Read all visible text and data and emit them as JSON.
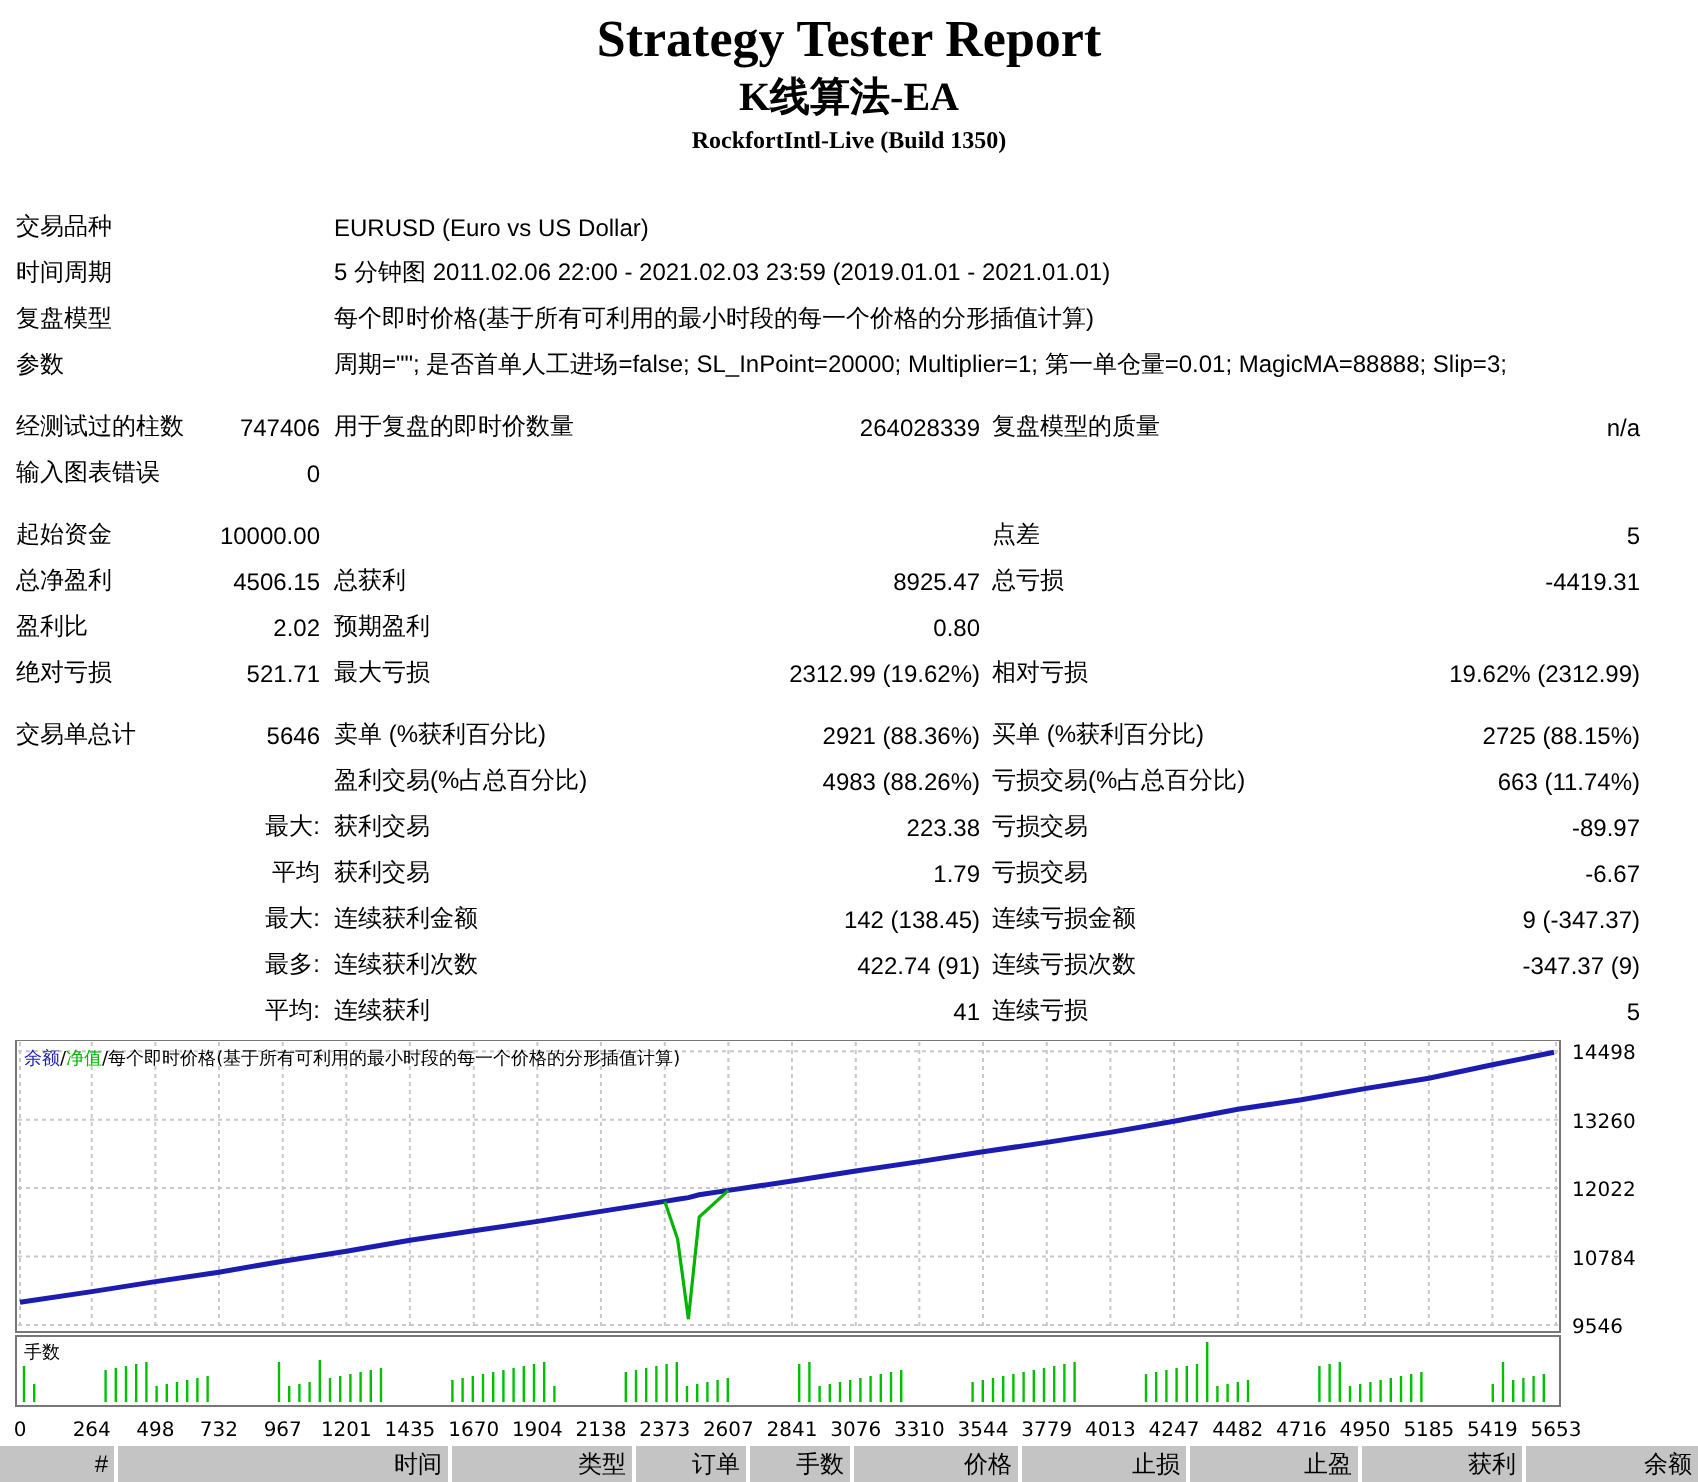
{
  "report": {
    "title": "Strategy Tester Report",
    "expert": "K线算法-EA",
    "server": "RockfortIntl-Live (Build 1350)"
  },
  "sections": [
    [
      {
        "label": "交易品种",
        "text": "EURUSD (Euro vs US Dollar)"
      },
      {
        "label": "时间周期",
        "text": "5 分钟图 2011.02.06 22:00 - 2021.02.03 23:59 (2019.01.01 - 2021.01.01)"
      },
      {
        "label": "复盘模型",
        "text": "每个即时价格(基于所有可利用的最小时段的每一个价格的分形插值计算)"
      },
      {
        "label": "参数",
        "text": "周期=\"\"; 是否首单人工进场=false; SL_InPoint=20000; Multiplier=1; 第一单仓量=0.01; MagicMA=88888; Slip=3;"
      }
    ],
    [
      {
        "label": "经测试过的柱数",
        "value": "747406",
        "label_2": "用于复盘的即时价数量",
        "value_2": "264028339",
        "label_3": "复盘模型的质量",
        "value_3": "n/a"
      },
      {
        "label": "输入图表错误",
        "value": "0"
      }
    ],
    [
      {
        "label": "起始资金",
        "value": "10000.00",
        "label_3": "点差",
        "value_3": "5"
      },
      {
        "label": "总净盈利",
        "value": "4506.15",
        "label_2": "总获利",
        "value_2": "8925.47",
        "label_3": "总亏损",
        "value_3": "-4419.31"
      },
      {
        "label": "盈利比",
        "value": "2.02",
        "label_2": "预期盈利",
        "value_2": "0.80"
      },
      {
        "label": "绝对亏损",
        "value": "521.71",
        "label_2": "最大亏损",
        "value_2": "2312.99 (19.62%)",
        "label_3": "相对亏损",
        "value_3": "19.62% (2312.99)"
      }
    ],
    [
      {
        "label": "交易单总计",
        "value": "5646",
        "label_2": "卖单 (%获利百分比)",
        "value_2": "2921 (88.36%)",
        "label_3": "买单 (%获利百分比)",
        "value_3": "2725 (88.15%)"
      },
      {
        "label_2": "盈利交易(%占总百分比)",
        "value_2": "4983 (88.26%)",
        "label_3": "亏损交易(%占总百分比)",
        "value_3": "663 (11.74%)"
      },
      {
        "prefix": "最大:",
        "label_2": "获利交易",
        "value_2": "223.38",
        "label_3": "亏损交易",
        "value_3": "-89.97"
      },
      {
        "prefix": "平均",
        "label_2": "获利交易",
        "value_2": "1.79",
        "label_3": "亏损交易",
        "value_3": "-6.67"
      },
      {
        "prefix": "最大:",
        "label_2": "连续获利金额",
        "value_2": "142 (138.45)",
        "label_3": "连续亏损金额",
        "value_3": "9 (-347.37)"
      },
      {
        "prefix": "最多:",
        "label_2": "连续获利次数",
        "value_2": "422.74 (91)",
        "label_3": "连续亏损次数",
        "value_3": "-347.37 (9)"
      },
      {
        "prefix": "平均:",
        "label_2": "连续获利",
        "value_2": "41",
        "label_3": "连续亏损",
        "value_3": "5"
      }
    ]
  ],
  "chart": {
    "legend": [
      {
        "kind": "series"
      },
      {
        "kind": "separator",
        "text": "/"
      },
      {
        "kind": "series"
      },
      {
        "kind": "separator",
        "text": "/"
      },
      {
        "kind": "note",
        "text": "每个即时价格(基于所有可利用的最小时段的每一个价格的分形插值计算)"
      }
    ],
    "volume_label": "手数",
    "chart_data": {
      "type": "line",
      "x": [
        0,
        264,
        498,
        732,
        967,
        1201,
        1435,
        1670,
        1904,
        2138,
        2373,
        2420,
        2460,
        2500,
        2607,
        2841,
        3076,
        3310,
        3544,
        3779,
        4013,
        4247,
        4482,
        4716,
        4950,
        5185,
        5419,
        5646
      ],
      "series": [
        {
          "name": "余额",
          "color": "#1c1cb0",
          "values": [
            9960,
            10150,
            10330,
            10500,
            10700,
            10880,
            11080,
            11250,
            11420,
            11600,
            11780,
            11820,
            11850,
            11900,
            11980,
            12150,
            12330,
            12500,
            12680,
            12850,
            13030,
            13230,
            13450,
            13620,
            13820,
            14010,
            14250,
            14480
          ]
        },
        {
          "name": "净值",
          "color": "#00b400",
          "values": [
            null,
            null,
            null,
            null,
            null,
            null,
            null,
            null,
            null,
            null,
            11780,
            11100,
            9650,
            11500,
            11980,
            null,
            null,
            null,
            null,
            null,
            null,
            null,
            null,
            null,
            null,
            null,
            null,
            null
          ]
        }
      ],
      "grid": true,
      "xlim": [
        0,
        5653
      ],
      "ylim": [
        9420,
        14700
      ],
      "xticks": [
        0,
        264,
        498,
        732,
        967,
        1201,
        1435,
        1670,
        1904,
        2138,
        2373,
        2607,
        2841,
        3076,
        3310,
        3544,
        3779,
        4013,
        4247,
        4482,
        4716,
        4950,
        5185,
        5419,
        5653
      ],
      "yticks": [
        9546,
        10784,
        12022,
        13260,
        14498
      ]
    }
  },
  "trades_table": {
    "columns": [
      "#",
      "时间",
      "类型",
      "订单",
      "手数",
      "价格",
      "止损",
      "止盈",
      "获利",
      "余额"
    ]
  }
}
